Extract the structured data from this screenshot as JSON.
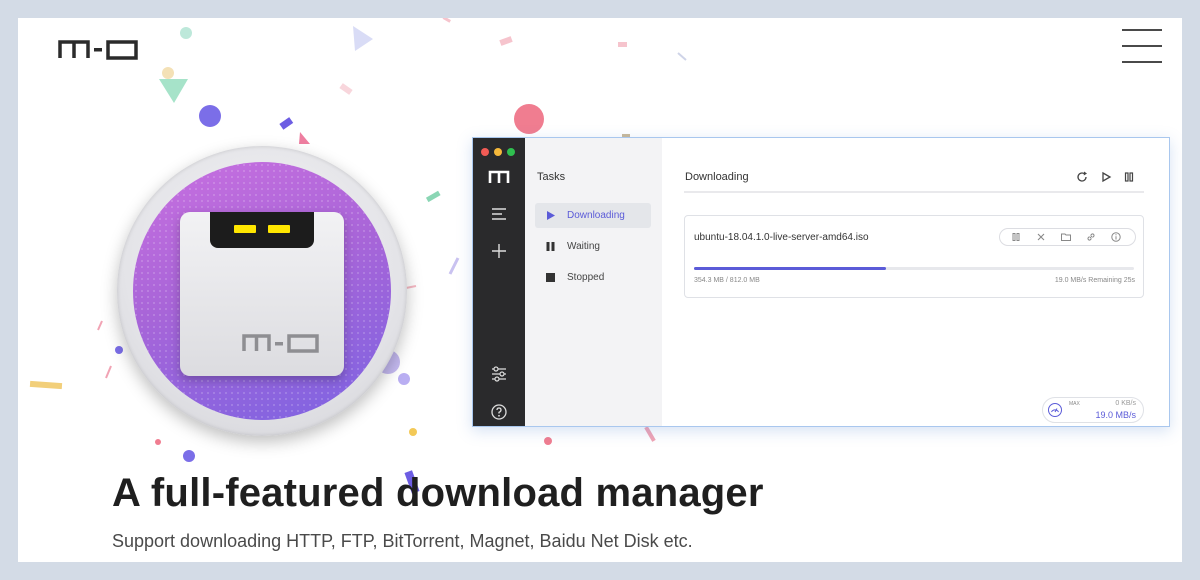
{
  "brand": {
    "logo_text": "m-o"
  },
  "app_window": {
    "tasks_title": "Tasks",
    "task_filters": [
      {
        "label": "Downloading",
        "icon": "play-icon",
        "active": true
      },
      {
        "label": "Waiting",
        "icon": "pause-icon",
        "active": false
      },
      {
        "label": "Stopped",
        "icon": "stop-icon",
        "active": false
      }
    ],
    "section_title": "Downloading",
    "download": {
      "filename": "ubuntu-18.04.1.0-live-server-amd64.iso",
      "size_text": "354.3 MB / 812.0 MB",
      "speed_text": "19.0 MB/s Remaining 25s",
      "progress": 0.436
    },
    "speed_meter": {
      "max_label": "MAX",
      "upload": "0 KB/s",
      "download": "19.0 MB/s"
    }
  },
  "hero": {
    "headline": "A full-featured download manager",
    "subline": "Support downloading HTTP, FTP, BitTorrent, Magnet, Baidu Net Disk etc."
  },
  "colors": {
    "accent": "#5b5bd8",
    "icon_gradient_start": "#c970e0",
    "icon_gradient_end": "#7c63e2",
    "eye_yellow": "#ffe600",
    "traffic_red": "#f25b55",
    "traffic_yellow": "#f6b93b",
    "traffic_green": "#2fbf4f"
  }
}
